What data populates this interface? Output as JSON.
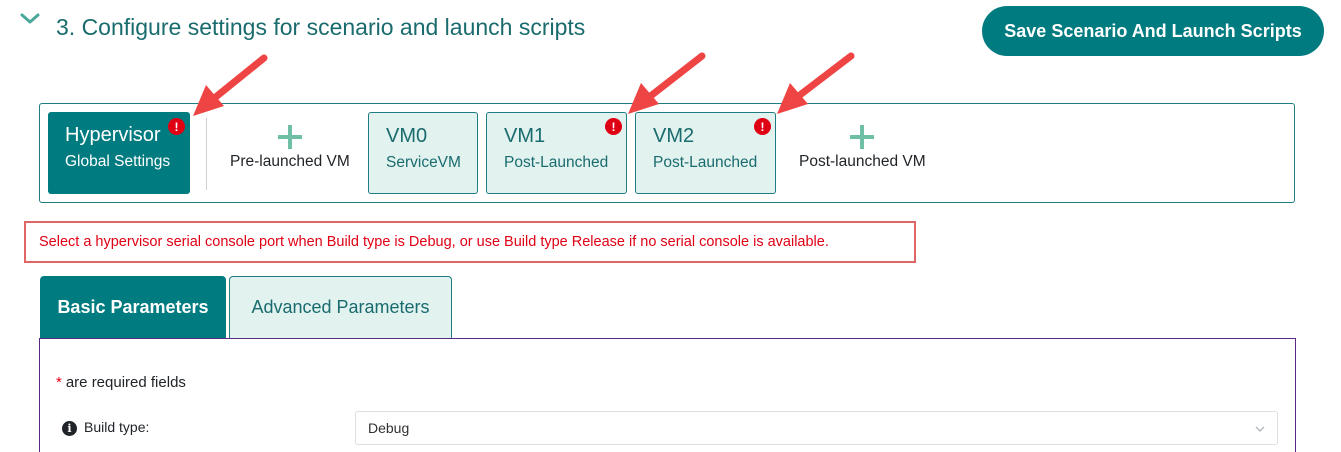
{
  "section": {
    "title": "3. Configure settings for scenario and launch scripts",
    "save_button_label": "Save Scenario And Launch Scripts"
  },
  "vm_tiles": [
    {
      "name": "Hypervisor",
      "sub": "Global Settings",
      "active": true,
      "error": true
    },
    {
      "name": "VM0",
      "sub": "ServiceVM",
      "active": false,
      "error": false
    },
    {
      "name": "VM1",
      "sub": "Post-Launched",
      "active": false,
      "error": true
    },
    {
      "name": "VM2",
      "sub": "Post-Launched",
      "active": false,
      "error": true
    }
  ],
  "add_buttons": {
    "pre_launched": "Pre-launched VM",
    "post_launched": "Post-launched VM"
  },
  "error_badge_glyph": "!",
  "error_message": "Select a hypervisor serial console port when Build type is Debug, or use Build type Release if no serial console is available.",
  "tabs": [
    {
      "label": "Basic Parameters",
      "active": true
    },
    {
      "label": "Advanced Parameters",
      "active": false
    }
  ],
  "form": {
    "required_star": "*",
    "required_note": "are required fields",
    "info_glyph": "i",
    "build_type_label": "Build type:",
    "build_type_value": "Debug"
  },
  "icons": {
    "section_toggle": "chevron-down-icon",
    "add": "plus-icon",
    "error": "exclamation-icon",
    "info": "info-icon",
    "dropdown": "chevron-down-icon"
  },
  "colors": {
    "primary": "#007b80",
    "primary_light": "#e1f2ef",
    "error": "#e00014",
    "annotation_arrow": "#ef4444",
    "add_plus": "#6fbfa6"
  }
}
